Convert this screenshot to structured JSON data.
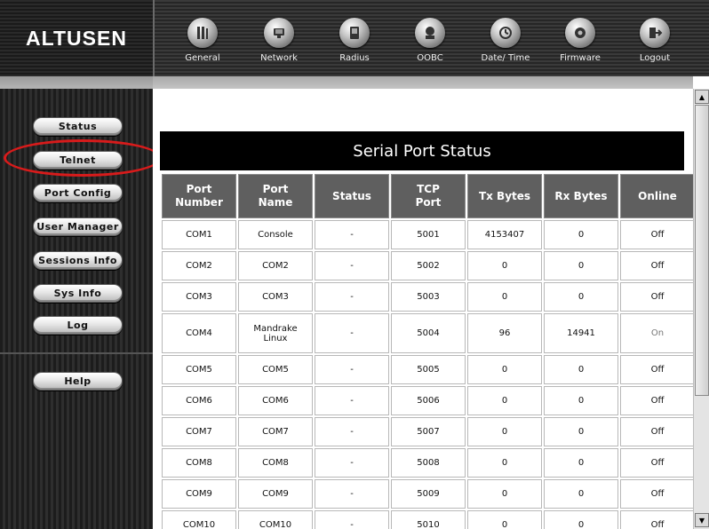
{
  "brand": {
    "logo": "ALTUSEN"
  },
  "nav": [
    {
      "label": "General",
      "icon": "general-icon"
    },
    {
      "label": "Network",
      "icon": "network-icon"
    },
    {
      "label": "Radius",
      "icon": "radius-icon"
    },
    {
      "label": "OOBC",
      "icon": "oobc-icon"
    },
    {
      "label": "Date/ Time",
      "icon": "date-time-icon"
    },
    {
      "label": "Firmware",
      "icon": "firmware-icon"
    },
    {
      "label": "Logout",
      "icon": "logout-icon"
    }
  ],
  "sidebar": {
    "items": [
      {
        "label": "Status"
      },
      {
        "label": "Telnet"
      },
      {
        "label": "Port Config"
      },
      {
        "label": "User Manager"
      },
      {
        "label": "Sessions Info"
      },
      {
        "label": "Sys Info"
      },
      {
        "label": "Log"
      },
      {
        "label": "Help"
      }
    ],
    "highlighted": "Telnet"
  },
  "main": {
    "title": "Serial Port Status",
    "columns": [
      {
        "line1": "Port",
        "line2": "Number"
      },
      {
        "line1": "Port",
        "line2": "Name"
      },
      {
        "line1": "Status",
        "line2": ""
      },
      {
        "line1": "TCP",
        "line2": "Port"
      },
      {
        "line1": "Tx Bytes",
        "line2": ""
      },
      {
        "line1": "Rx Bytes",
        "line2": ""
      },
      {
        "line1": "Online",
        "line2": ""
      }
    ],
    "rows": [
      {
        "port": "COM1",
        "name_line1": "Console",
        "name_line2": "",
        "status": "-",
        "tcp": "5001",
        "tx": "4153407",
        "rx": "0",
        "online": "Off"
      },
      {
        "port": "COM2",
        "name_line1": "COM2",
        "name_line2": "",
        "status": "-",
        "tcp": "5002",
        "tx": "0",
        "rx": "0",
        "online": "Off"
      },
      {
        "port": "COM3",
        "name_line1": "COM3",
        "name_line2": "",
        "status": "-",
        "tcp": "5003",
        "tx": "0",
        "rx": "0",
        "online": "Off"
      },
      {
        "port": "COM4",
        "name_line1": "Mandrake",
        "name_line2": "Linux",
        "status": "-",
        "tcp": "5004",
        "tx": "96",
        "rx": "14941",
        "online": "On"
      },
      {
        "port": "COM5",
        "name_line1": "COM5",
        "name_line2": "",
        "status": "-",
        "tcp": "5005",
        "tx": "0",
        "rx": "0",
        "online": "Off"
      },
      {
        "port": "COM6",
        "name_line1": "COM6",
        "name_line2": "",
        "status": "-",
        "tcp": "5006",
        "tx": "0",
        "rx": "0",
        "online": "Off"
      },
      {
        "port": "COM7",
        "name_line1": "COM7",
        "name_line2": "",
        "status": "-",
        "tcp": "5007",
        "tx": "0",
        "rx": "0",
        "online": "Off"
      },
      {
        "port": "COM8",
        "name_line1": "COM8",
        "name_line2": "",
        "status": "-",
        "tcp": "5008",
        "tx": "0",
        "rx": "0",
        "online": "Off"
      },
      {
        "port": "COM9",
        "name_line1": "COM9",
        "name_line2": "",
        "status": "-",
        "tcp": "5009",
        "tx": "0",
        "rx": "0",
        "online": "Off"
      },
      {
        "port": "COM10",
        "name_line1": "COM10",
        "name_line2": "",
        "status": "-",
        "tcp": "5010",
        "tx": "0",
        "rx": "0",
        "online": "Off"
      }
    ]
  },
  "colors": {
    "highlight_ring": "#d81b1b",
    "header_cell": "#5f5f5f",
    "title_bar": "#000000"
  }
}
